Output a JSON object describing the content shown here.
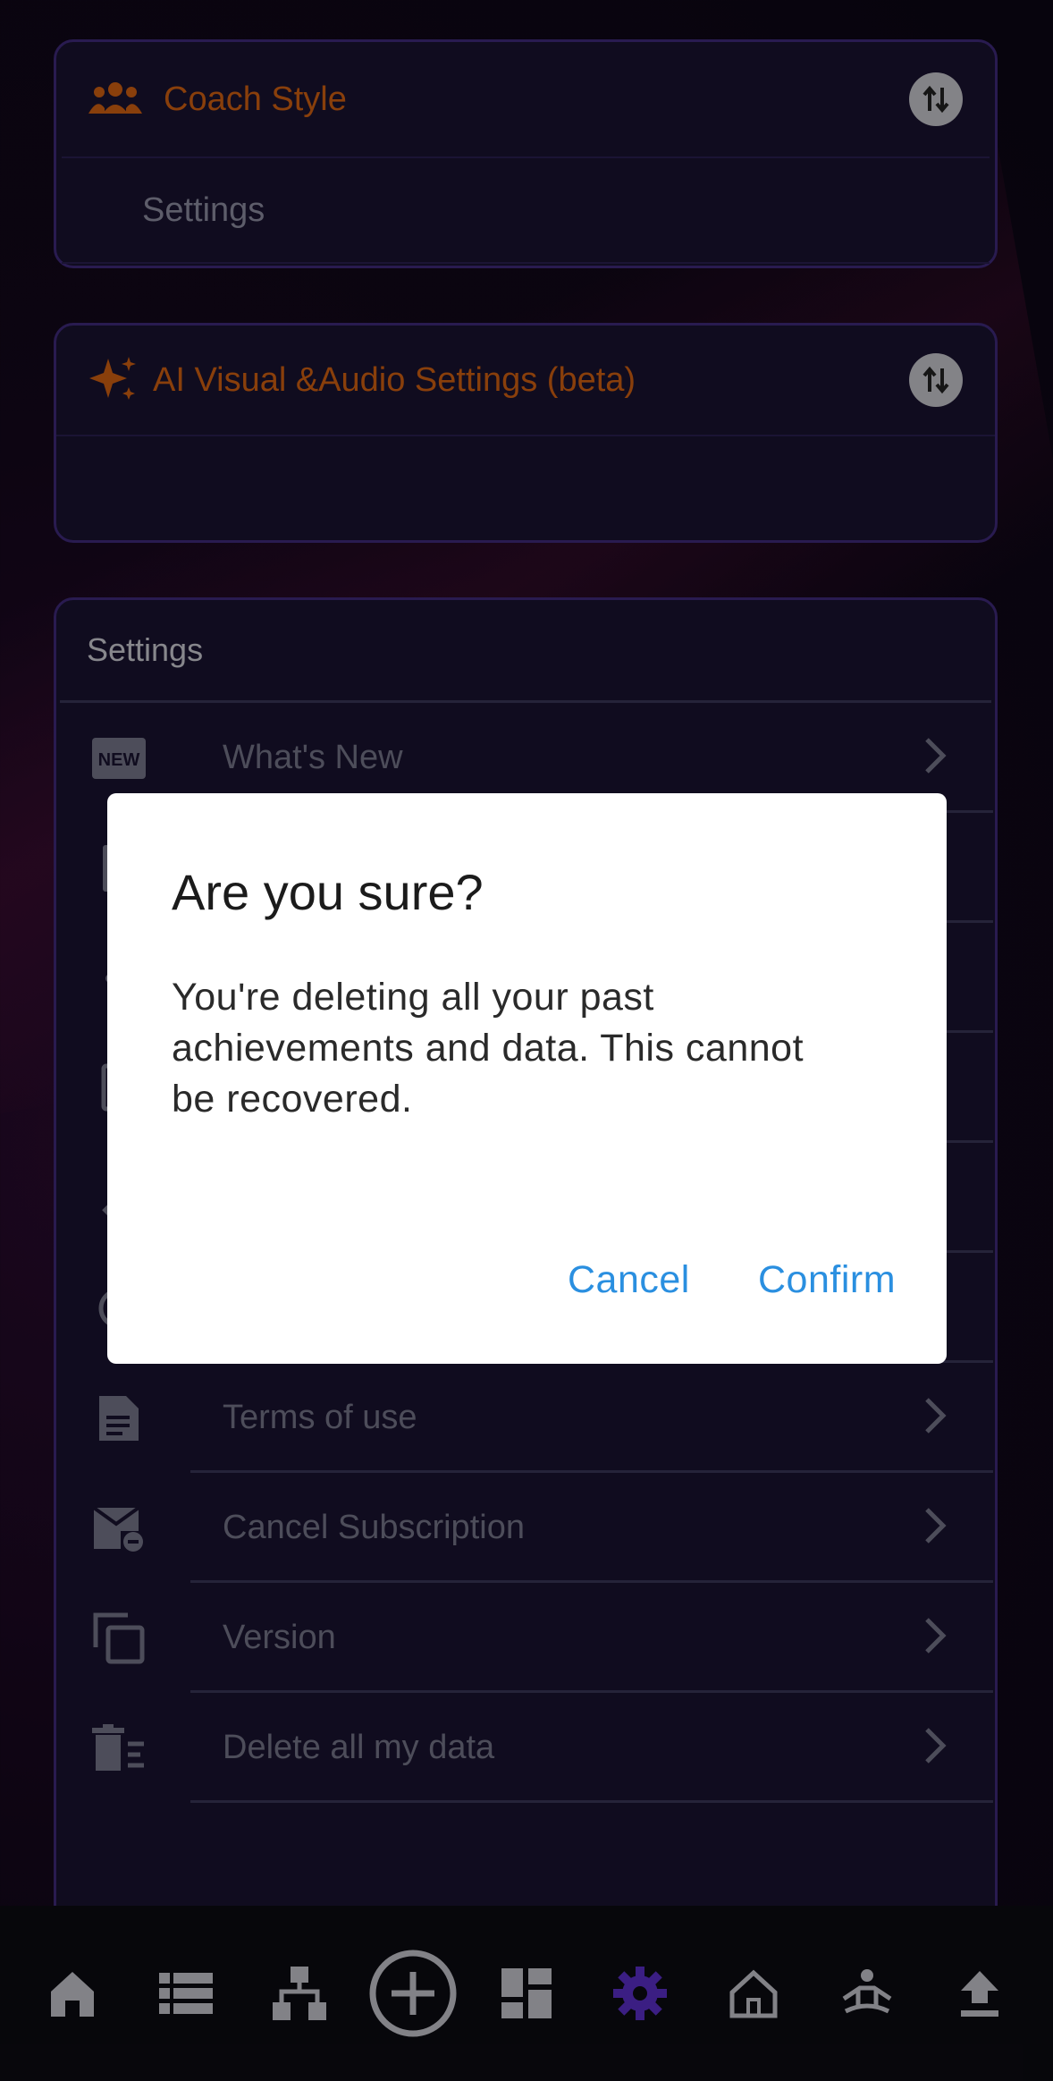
{
  "coach_card": {
    "title": "Coach Style",
    "sub_label": "Settings"
  },
  "ai_card": {
    "title": "AI Visual &Audio Settings (beta)"
  },
  "settings": {
    "title": "Settings",
    "rows": [
      {
        "label": "What's New",
        "icon": "new-badge-icon"
      },
      {
        "label": "",
        "icon": "doc-icon"
      },
      {
        "label": "",
        "icon": "share-icon"
      },
      {
        "label": "",
        "icon": "note-icon"
      },
      {
        "label": "",
        "icon": "pencil-icon"
      },
      {
        "label": "",
        "icon": "info-icon"
      },
      {
        "label": "Terms of use",
        "icon": "document-icon"
      },
      {
        "label": "Cancel Subscription",
        "icon": "mail-minus-icon"
      },
      {
        "label": "Version",
        "icon": "copy-icon"
      },
      {
        "label": "Delete all my data",
        "icon": "delete-list-icon"
      }
    ]
  },
  "dialog": {
    "title": "Are you sure?",
    "body": "You're deleting all your past achievements and data. This cannot be recovered.",
    "cancel": "Cancel",
    "confirm": "Confirm"
  },
  "nav": {
    "items": [
      "home-icon",
      "list-icon",
      "sitemap-icon",
      "add-circle-icon",
      "dashboard-icon",
      "gear-icon",
      "house-outline-icon",
      "meditation-icon",
      "upload-icon"
    ],
    "active": "gear-icon"
  },
  "colors": {
    "accent_orange": "#d36112",
    "dialog_button": "#2a8fe0",
    "active_nav": "#5b2fc9"
  }
}
